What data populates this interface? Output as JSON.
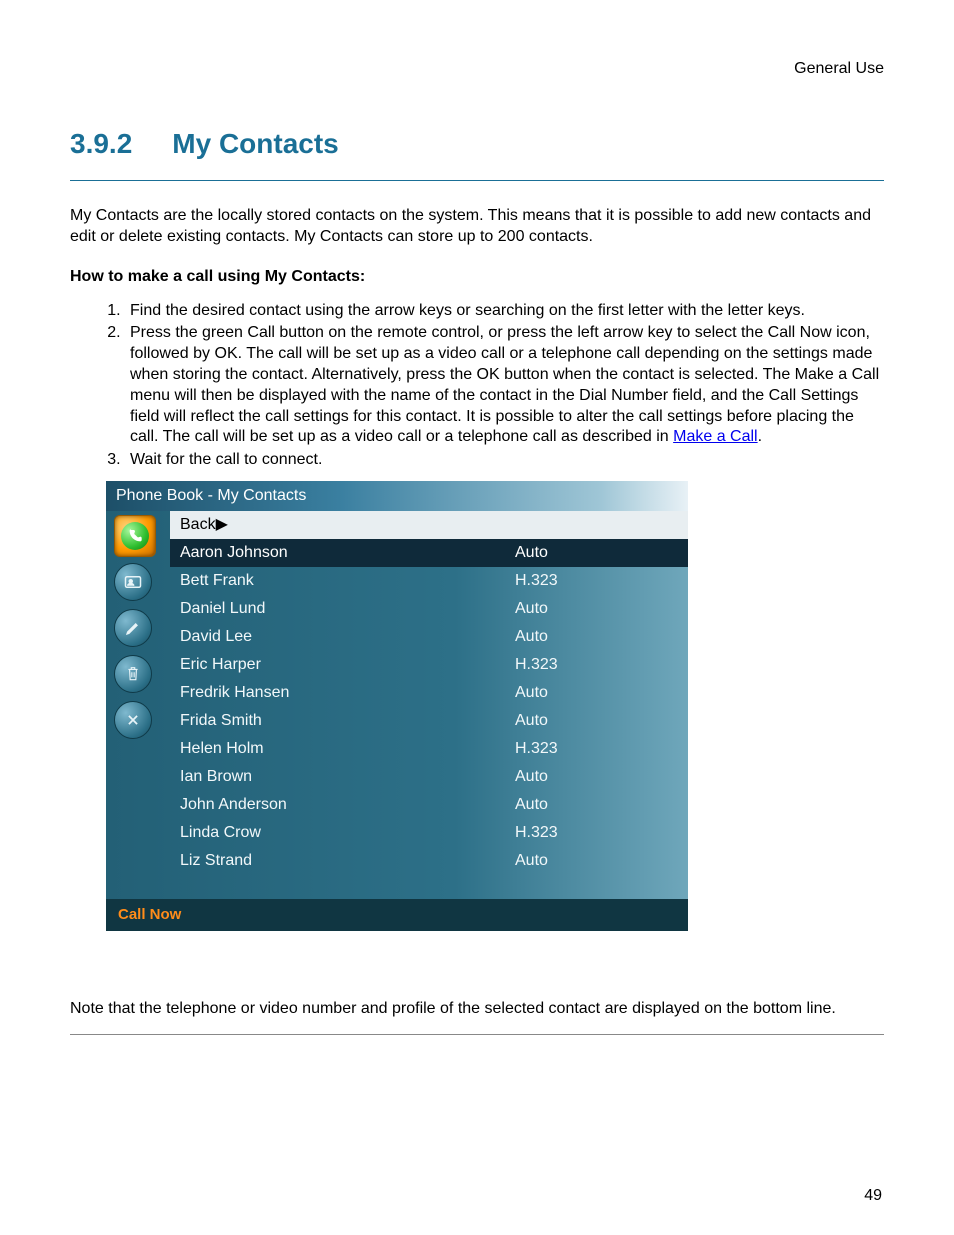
{
  "header": {
    "right": "General Use"
  },
  "section": {
    "number": "3.9.2",
    "title": "My Contacts"
  },
  "intro": "My Contacts are the locally stored contacts on the system. This means that it is possible to add new contacts and edit or delete existing contacts. My Contacts can store up to 200 contacts.",
  "subhead": "How to make a call using My Contacts:",
  "steps": {
    "s1": "Find the desired contact using the arrow keys or searching on the first letter with the letter keys.",
    "s2a": "Press the green Call button on the remote control, or press the left arrow key to select the Call Now icon, followed by OK. The call will be set up as a video call or a telephone call depending on the settings made when storing the contact. Alternatively, press the OK button when the contact is selected. The Make a Call menu will then be displayed with the name of the contact in the Dial Number field, and the Call Settings field will reflect the call settings for this contact. It is possible to alter the call settings before placing the call. The call will be set up as a video call or a telephone call as described in ",
    "s2link": "Make a Call",
    "s2b": ".",
    "s3": "Wait for the call to connect."
  },
  "phonebook": {
    "title": "Phone Book - My Contacts",
    "back": "Back▶",
    "footer": "Call Now",
    "contacts": [
      {
        "name": "Aaron Johnson",
        "proto": "Auto",
        "selected": true
      },
      {
        "name": "Bett Frank",
        "proto": "H.323"
      },
      {
        "name": "Daniel Lund",
        "proto": "Auto"
      },
      {
        "name": "David Lee",
        "proto": "Auto"
      },
      {
        "name": "Eric Harper",
        "proto": "H.323"
      },
      {
        "name": "Fredrik Hansen",
        "proto": "Auto"
      },
      {
        "name": "Frida Smith",
        "proto": "Auto"
      },
      {
        "name": "Helen Holm",
        "proto": "H.323"
      },
      {
        "name": "Ian Brown",
        "proto": "Auto"
      },
      {
        "name": "John Anderson",
        "proto": "Auto"
      },
      {
        "name": "Linda Crow",
        "proto": "H.323"
      },
      {
        "name": "Liz Strand",
        "proto": "Auto"
      }
    ]
  },
  "note": "Note that the telephone or video number and profile of the selected contact are displayed on the bottom line.",
  "pagenum": "49"
}
